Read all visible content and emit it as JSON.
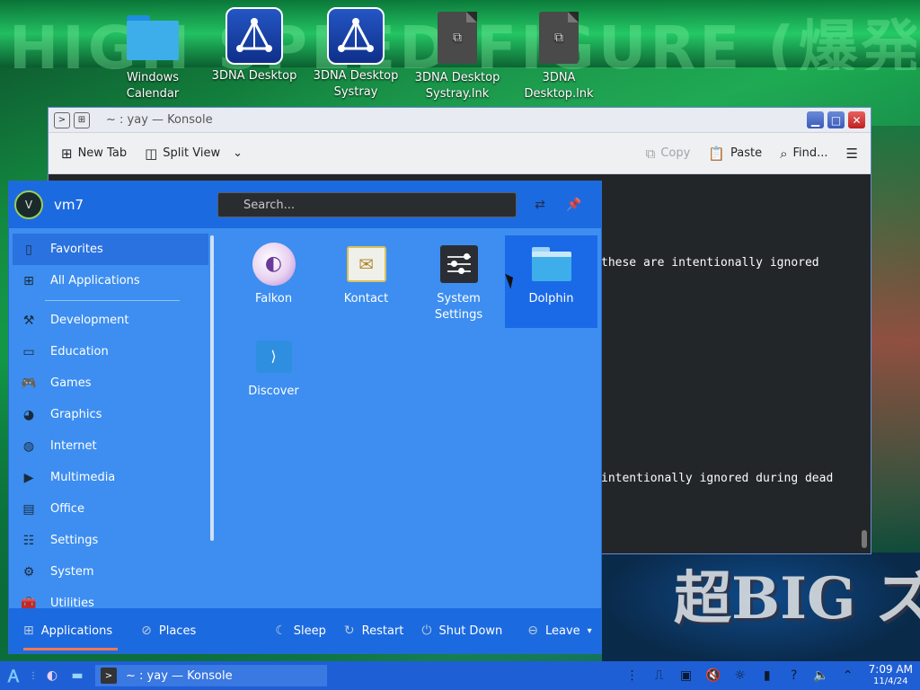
{
  "desktop": {
    "icons": [
      {
        "label": "Windows Calendar",
        "icon": "folder-icon"
      },
      {
        "label": "3DNA Desktop",
        "icon": "3dna-icon"
      },
      {
        "label": "3DNA Desktop Systray",
        "icon": "3dna-icon"
      },
      {
        "label": "3DNA Desktop Systray.lnk",
        "icon": "shortcut-file-icon"
      },
      {
        "label": "3DNA Desktop.lnk",
        "icon": "shortcut-file-icon"
      }
    ],
    "wallpaper_banner": "HIGH SPEED FIGURE (爆発時)",
    "wallpaper_lower": "超BIG ズ!"
  },
  "konsole": {
    "title": "~ : yay — Konsole",
    "toolbar": {
      "new_tab": "New Tab",
      "split_view": "Split View",
      "copy": "Copy",
      "paste": "Paste",
      "find": "Find..."
    },
    "terminal_lines": [
      "these are intentionally ignored",
      "intentionally ignored during dead"
    ]
  },
  "launcher": {
    "user": "vm7",
    "avatar_initial": "V",
    "search_placeholder": "Search...",
    "categories": [
      {
        "label": "Favorites",
        "icon": "bookmark-icon"
      },
      {
        "label": "All Applications",
        "icon": "grid-icon"
      },
      {
        "label": "Development",
        "icon": "hammer-icon"
      },
      {
        "label": "Education",
        "icon": "education-icon"
      },
      {
        "label": "Games",
        "icon": "gamepad-icon"
      },
      {
        "label": "Graphics",
        "icon": "palette-icon"
      },
      {
        "label": "Internet",
        "icon": "globe-icon"
      },
      {
        "label": "Multimedia",
        "icon": "multimedia-icon"
      },
      {
        "label": "Office",
        "icon": "document-icon"
      },
      {
        "label": "Settings",
        "icon": "sliders-icon"
      },
      {
        "label": "System",
        "icon": "gear-icon"
      },
      {
        "label": "Utilities",
        "icon": "toolbox-icon"
      }
    ],
    "apps": [
      {
        "label": "Falkon",
        "icon": "falkon-icon"
      },
      {
        "label": "Kontact",
        "icon": "kontact-icon"
      },
      {
        "label": "System Settings",
        "icon": "system-settings-icon"
      },
      {
        "label": "Dolphin",
        "icon": "dolphin-icon"
      },
      {
        "label": "Discover",
        "icon": "discover-icon"
      }
    ],
    "footer": {
      "applications": "Applications",
      "places": "Places",
      "sleep": "Sleep",
      "restart": "Restart",
      "shut_down": "Shut Down",
      "leave": "Leave"
    }
  },
  "taskbar": {
    "task_title": "~ : yay — Konsole",
    "time": "7:09 AM",
    "date": "11/4/24"
  },
  "colors": {
    "launcher_bg": "#3d8ef0",
    "launcher_header": "#1c6ae0",
    "taskbar": "#1f5fd6",
    "accent_underline": "#f47750"
  }
}
